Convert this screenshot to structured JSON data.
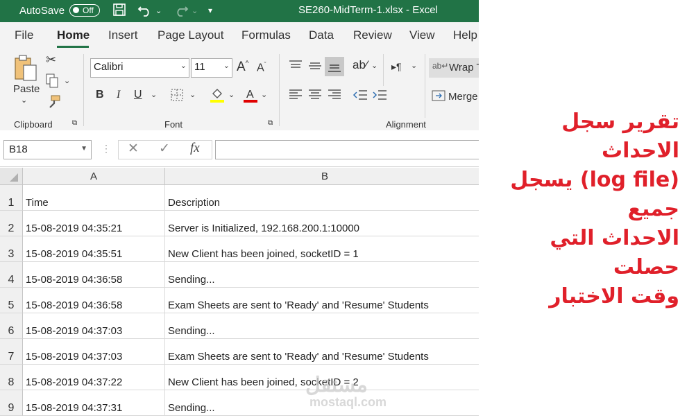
{
  "titlebar": {
    "autosave_label": "AutoSave",
    "autosave_state": "Off",
    "title": "SE260-MidTerm-1.xlsx  -  Excel"
  },
  "tabs": [
    "File",
    "Home",
    "Insert",
    "Page Layout",
    "Formulas",
    "Data",
    "Review",
    "View",
    "Help"
  ],
  "ribbon": {
    "paste_label": "Paste",
    "font_name": "Calibri",
    "font_size": "11",
    "bold": "B",
    "italic": "I",
    "underline": "U",
    "wrap_text": "Wrap T",
    "merge": "Merge",
    "groups": {
      "clipboard": "Clipboard",
      "font": "Font",
      "alignment": "Alignment"
    }
  },
  "formula_bar": {
    "name_box": "B18",
    "cancel": "✕",
    "enter": "✓",
    "fx": "fx",
    "value": ""
  },
  "columns": [
    "A",
    "B"
  ],
  "rows": [
    {
      "num": "1",
      "a": "Time",
      "b": "Description"
    },
    {
      "num": "2",
      "a": "15-08-2019 04:35:21",
      "b": "Server is Initialized, 192.168.200.1:10000"
    },
    {
      "num": "3",
      "a": "15-08-2019 04:35:51",
      "b": "New Client has been joined, socketID = 1"
    },
    {
      "num": "4",
      "a": "15-08-2019 04:36:58",
      "b": "Sending..."
    },
    {
      "num": "5",
      "a": "15-08-2019 04:36:58",
      "b": "Exam Sheets are sent to 'Ready' and 'Resume' Students"
    },
    {
      "num": "6",
      "a": "15-08-2019 04:37:03",
      "b": "Sending..."
    },
    {
      "num": "7",
      "a": "15-08-2019 04:37:03",
      "b": "Exam Sheets are sent to 'Ready' and 'Resume' Students"
    },
    {
      "num": "8",
      "a": "15-08-2019 04:37:22",
      "b": "New Client has been joined, socketID = 2"
    },
    {
      "num": "9",
      "a": "15-08-2019 04:37:31",
      "b": "Sending..."
    }
  ],
  "annotation": {
    "lines": [
      "تقرير سجل الاحداث",
      "(log file) يسجل جميع",
      "الاحداث التي حصلت",
      "وقت الاختبار"
    ],
    "color": "#e0202a"
  },
  "watermark": {
    "arabic": "مستقل",
    "latin": "mostaql.com"
  },
  "colors": {
    "excel_green": "#217346"
  }
}
